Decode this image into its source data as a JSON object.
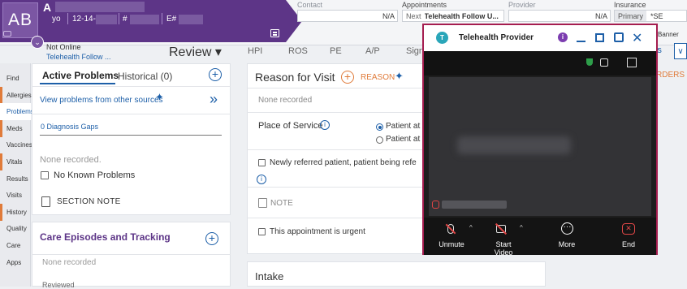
{
  "patient": {
    "initials": "AB",
    "initial_letter": "A",
    "age": "yo",
    "dob_prefix": "12-14-",
    "mrn_prefix": "#",
    "enc_prefix": "E#",
    "expand_caret": "⌄"
  },
  "header": {
    "contact_label": "Contact",
    "contact_value": "N/A",
    "appointments_label": "Appointments",
    "appointment_next": "Next",
    "appointment_value": "Telehealth Follow U...",
    "provider_label": "Provider",
    "provider_value": "N/A",
    "insurance_label": "Insurance",
    "insurance_primary": "Primary",
    "insurance_value": "*SE",
    "banner_label": "Banner",
    "online_status": "Not Online",
    "telehealth_link": "Telehealth Follow ..."
  },
  "tabs": {
    "review": "Review ▾",
    "hpi": "HPI",
    "ros": "ROS",
    "pe": "PE",
    "ap": "A/P",
    "sign": "Sign",
    "right_button": "gress",
    "right_chevron": "∨"
  },
  "nav": [
    "Find",
    "Allergies",
    "Problems",
    "Meds",
    "Vaccines",
    "Vitals",
    "Results",
    "Visits",
    "History",
    "Quality",
    "Care",
    "Apps"
  ],
  "nav_active": "Problems",
  "problems": {
    "tab_active": "Active Problems",
    "tab_historical": "Historical (0)",
    "add_icon": "+",
    "view_other_link": "View problems from other sources",
    "sparkle": "✦",
    "collapse": "»",
    "gaps_link": "0 Diagnosis Gaps",
    "none_recorded": "None recorded.",
    "no_known_label": "No Known Problems",
    "section_note": "SECTION NOTE"
  },
  "care": {
    "title": "Care Episodes and Tracking",
    "add_icon": "+",
    "none_recorded": "None recorded",
    "reviewed": "Reviewed"
  },
  "reason": {
    "title": "Reason for Visit",
    "add_icon": "+",
    "button": "REASON",
    "sparkle": "✦",
    "none_recorded": "None recorded",
    "pos_label": "Place of Service",
    "info": "i",
    "pos_option_1": "Patient at",
    "pos_option_2": "Patient at",
    "newref_label": "Newly referred patient, patient being refe",
    "note_label": "NOTE",
    "urgent_label": "This appointment is urgent"
  },
  "intake": {
    "title": "Intake"
  },
  "orders": {
    "label": "RDERS"
  },
  "telehealth": {
    "logo": "T",
    "title": "Telehealth Provider",
    "info": "i",
    "close": "✕",
    "unmute_label": "Unmute",
    "startvideo_label": "Start Video",
    "more_label": "More",
    "more_icon": "···",
    "end_label": "End",
    "end_icon": "✕",
    "caret": "^"
  },
  "colors": {
    "brand_purple": "#5d3587",
    "link_blue": "#1d5fa8",
    "accent_orange": "#e07b3a",
    "window_border": "#a51d4f"
  }
}
